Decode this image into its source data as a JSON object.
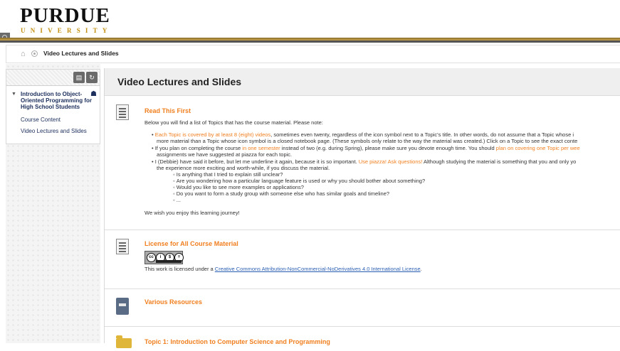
{
  "header": {
    "logo_main": "PURDUE",
    "logo_sub": "UNIVERSITY"
  },
  "breadcrumb": {
    "current": "Video Lectures and Slides"
  },
  "sidebar": {
    "course_title": "Introduction to Object-Oriented Programming for High School Students",
    "items": [
      {
        "label": "Course Content"
      },
      {
        "label": "Video Lectures and Slides"
      }
    ]
  },
  "main": {
    "title": "Video Lectures and Slides",
    "items": [
      {
        "title": "Read This First",
        "intro": "Below you will find a list of Topics that has the course material. Please note:",
        "b1_highlight": "Each Topic is covered by at least 8 (eight) videos",
        "b1_rest": ", sometimes even twenty, regardless of the icon symbol next to a Topic's title. In other words, do not assume that a Topic whose i",
        "b1_line2": "more material than a Topic whose icon symbol is a closed notebook page. (These symbols only relate to the way the material was created.) Click on a Topic to see the exact conte",
        "b2_pre": "If you plan on completing the course ",
        "b2_highlight": "in one semester",
        "b2_mid": " instead of two (e.g. during Spring), please make sure you devote enough time. You should ",
        "b2_highlight2": "plan on covering one Topic per wee",
        "b2_line2": "assignments we have suggested at piazza for each topic.",
        "b3_pre": "I (Debbie) have said it before, but let me underline it again, because it is so important. ",
        "b3_highlight": "Use piazza! Ask questions!",
        "b3_rest": " Although studying the material is something that you and only yo",
        "b3_line2": "the experience more exciting and worth-while, if you discuss the material.",
        "sub_bullets": [
          "Is anything that I tried to explain still unclear?",
          "Are you wondering how a particular language feature is used or why you should bother about something?",
          "Would you like to see more examples or applications?",
          "Do you want to form a study group with someone else who has similar goals and timeline?",
          "..."
        ],
        "closing": "We wish you enjoy this learning journey!"
      },
      {
        "title": "License for All Course Material",
        "license_prefix": "This work is licensed under a ",
        "license_link": "Creative Commons Attribution-NonCommercial-NoDerivatives 4.0 International License",
        "license_suffix": "."
      },
      {
        "title": "Various Resources"
      },
      {
        "title": "Topic 1: Introduction to Computer Science and Programming"
      }
    ]
  },
  "icons": {
    "doc": "document-icon",
    "book": "book-icon",
    "folder": "folder-icon",
    "home": "home-icon"
  }
}
